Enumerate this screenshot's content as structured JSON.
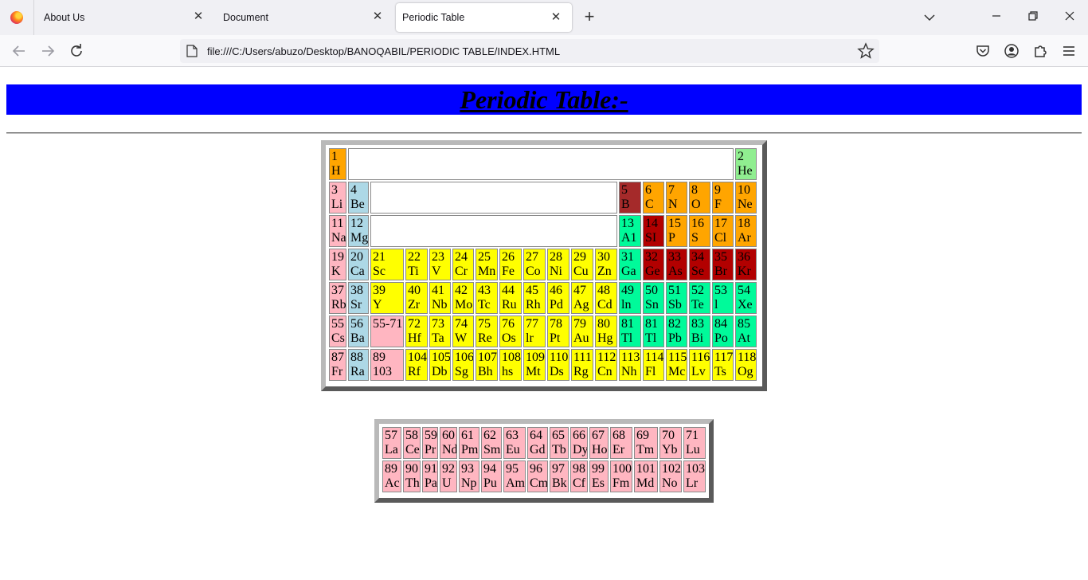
{
  "browser": {
    "tabs": [
      {
        "label": "About Us",
        "close": "✕"
      },
      {
        "label": "Document",
        "close": "✕"
      },
      {
        "label": "Periodic Table",
        "close": "✕"
      }
    ],
    "new_tab": "+",
    "url": "file:///C:/Users/abuzo/Desktop/BANOQABIL/PERIODIC TABLE/INDEX.HTML"
  },
  "page": {
    "heading": "Periodic Table:-"
  },
  "colors": {
    "alkali": "#ffb6c1",
    "alkaline": "#add8e6",
    "transition": "#ffff00",
    "nonmetal": "#ffa500",
    "noble_gas": "#90ee90",
    "metalloid": "#a52a2a",
    "post_transition": "#00fa9a",
    "dark_red": "#b20000",
    "heading_bg": "#0000ff"
  },
  "main_table": {
    "rows": [
      [
        [
          "1",
          "H",
          "nonmetal"
        ],
        null,
        [
          "2",
          "He",
          "noble_gas"
        ]
      ],
      [
        [
          "3",
          "Li",
          "alkali"
        ],
        [
          "4",
          "Be",
          "alkaline"
        ],
        null,
        [
          "5",
          "B",
          "metalloid"
        ],
        [
          "6",
          "C",
          "nonmetal"
        ],
        [
          "7",
          "N",
          "nonmetal"
        ],
        [
          "8",
          "O",
          "nonmetal"
        ],
        [
          "9",
          "F",
          "nonmetal"
        ],
        [
          "10",
          "Ne",
          "nonmetal"
        ]
      ],
      [
        [
          "11",
          "Na",
          "alkali"
        ],
        [
          "12",
          "Mg",
          "alkaline"
        ],
        null,
        [
          "13",
          "A1",
          "post_transition"
        ],
        [
          "14",
          "SI",
          "dark_red"
        ],
        [
          "15",
          "P",
          "nonmetal"
        ],
        [
          "16",
          "S",
          "nonmetal"
        ],
        [
          "17",
          "Cl",
          "nonmetal"
        ],
        [
          "18",
          "Ar",
          "nonmetal"
        ]
      ],
      [
        [
          "19",
          "K",
          "alkali"
        ],
        [
          "20",
          "Ca",
          "alkaline"
        ],
        [
          "21",
          "Sc",
          "transition"
        ],
        [
          "22",
          "Ti",
          "transition"
        ],
        [
          "23",
          "V",
          "transition"
        ],
        [
          "24",
          "Cr",
          "transition"
        ],
        [
          "25",
          "Mn",
          "transition"
        ],
        [
          "26",
          "Fe",
          "transition"
        ],
        [
          "27",
          "Co",
          "transition"
        ],
        [
          "28",
          "Ni",
          "transition"
        ],
        [
          "29",
          "Cu",
          "transition"
        ],
        [
          "30",
          "Zn",
          "transition"
        ],
        [
          "31",
          "Ga",
          "post_transition"
        ],
        [
          "32",
          "Ge",
          "dark_red"
        ],
        [
          "33",
          "As",
          "dark_red"
        ],
        [
          "34",
          "Se",
          "dark_red"
        ],
        [
          "35",
          "Br",
          "dark_red"
        ],
        [
          "36",
          "Kr",
          "dark_red"
        ]
      ],
      [
        [
          "37",
          "Rb",
          "alkali"
        ],
        [
          "38",
          "Sr",
          "alkaline"
        ],
        [
          "39",
          "Y",
          "transition"
        ],
        [
          "40",
          "Zr",
          "transition"
        ],
        [
          "41",
          "Nb",
          "transition"
        ],
        [
          "42",
          "Mo",
          "transition"
        ],
        [
          "43",
          "Tc",
          "transition"
        ],
        [
          "44",
          "Ru",
          "transition"
        ],
        [
          "45",
          "Rh",
          "transition"
        ],
        [
          "46",
          "Pd",
          "transition"
        ],
        [
          "47",
          "Ag",
          "transition"
        ],
        [
          "48",
          "Cd",
          "transition"
        ],
        [
          "49",
          "ln",
          "post_transition"
        ],
        [
          "50",
          "Sn",
          "post_transition"
        ],
        [
          "51",
          "Sb",
          "post_transition"
        ],
        [
          "52",
          "Te",
          "post_transition"
        ],
        [
          "53",
          "l",
          "post_transition"
        ],
        [
          "54",
          "Xe",
          "post_transition"
        ]
      ],
      [
        [
          "55",
          "Cs",
          "alkali"
        ],
        [
          "56",
          "Ba",
          "alkaline"
        ],
        [
          "55-71",
          "",
          "alkali"
        ],
        [
          "72",
          "Hf",
          "transition"
        ],
        [
          "73",
          "Ta",
          "transition"
        ],
        [
          "74",
          "W",
          "transition"
        ],
        [
          "75",
          "Re",
          "transition"
        ],
        [
          "76",
          "Os",
          "transition"
        ],
        [
          "77",
          "lr",
          "transition"
        ],
        [
          "78",
          "Pt",
          "transition"
        ],
        [
          "79",
          "Au",
          "transition"
        ],
        [
          "80",
          "Hg",
          "transition"
        ],
        [
          "81",
          "Tl",
          "post_transition"
        ],
        [
          "81",
          "Tl",
          "post_transition"
        ],
        [
          "82",
          "Pb",
          "post_transition"
        ],
        [
          "83",
          "Bi",
          "post_transition"
        ],
        [
          "84",
          "Po",
          "post_transition"
        ],
        [
          "85",
          "At",
          "post_transition"
        ]
      ],
      [
        [
          "87",
          "Fr",
          "alkali"
        ],
        [
          "88",
          "Ra",
          "alkaline"
        ],
        [
          "89",
          "103",
          "alkali"
        ],
        [
          "104",
          "Rf",
          "transition"
        ],
        [
          "105",
          "Db",
          "transition"
        ],
        [
          "106",
          "Sg",
          "transition"
        ],
        [
          "107",
          "Bh",
          "transition"
        ],
        [
          "108",
          "hs",
          "transition"
        ],
        [
          "109",
          "Mt",
          "transition"
        ],
        [
          "110",
          "Ds",
          "transition"
        ],
        [
          "111",
          "Rg",
          "transition"
        ],
        [
          "112",
          "Cn",
          "transition"
        ],
        [
          "113",
          "Nh",
          "transition"
        ],
        [
          "114",
          "Fl",
          "transition"
        ],
        [
          "115",
          "Mc",
          "transition"
        ],
        [
          "116",
          "Lv",
          "transition"
        ],
        [
          "117",
          "Ts",
          "transition"
        ],
        [
          "118",
          "Og",
          "transition"
        ]
      ]
    ]
  },
  "ln_table": {
    "rows": [
      [
        [
          "57",
          "La"
        ],
        [
          "58",
          "Ce"
        ],
        [
          "59",
          "Pr"
        ],
        [
          "60",
          "Nd"
        ],
        [
          "61",
          "Pm"
        ],
        [
          "62",
          "Sm"
        ],
        [
          "63",
          "Eu"
        ],
        [
          "64",
          "Gd"
        ],
        [
          "65",
          "Tb"
        ],
        [
          "66",
          "Dy"
        ],
        [
          "67",
          "Ho"
        ],
        [
          "68",
          "Er"
        ],
        [
          "69",
          "Tm"
        ],
        [
          "70",
          "Yb"
        ],
        [
          "71",
          "Lu"
        ]
      ],
      [
        [
          "89",
          "Ac"
        ],
        [
          "90",
          "Th"
        ],
        [
          "91",
          "Pa"
        ],
        [
          "92",
          "U"
        ],
        [
          "93",
          "Np"
        ],
        [
          "94",
          "Pu"
        ],
        [
          "95",
          "Am"
        ],
        [
          "96",
          "Cm"
        ],
        [
          "97",
          "Bk"
        ],
        [
          "98",
          "Cf"
        ],
        [
          "99",
          "Es"
        ],
        [
          "100",
          "Fm"
        ],
        [
          "101",
          "Md"
        ],
        [
          "102",
          "No"
        ],
        [
          "103",
          "Lr"
        ]
      ]
    ]
  }
}
